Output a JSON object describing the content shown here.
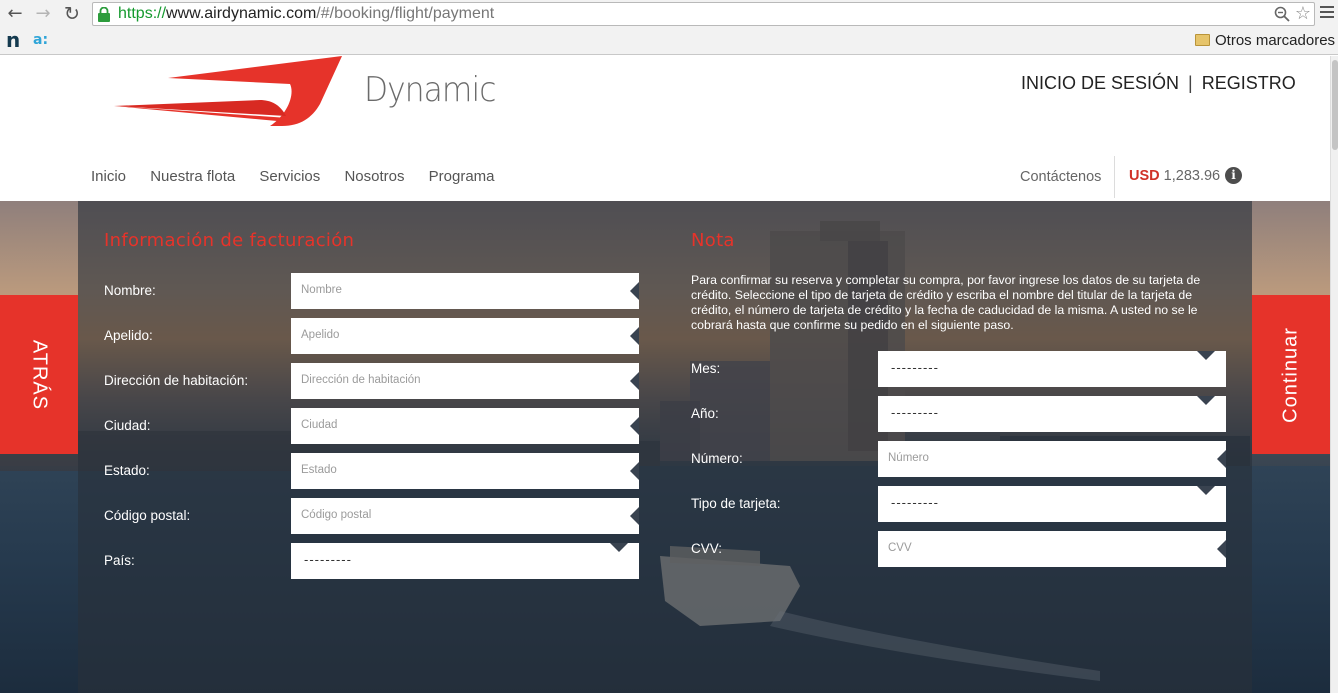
{
  "browser": {
    "url_scheme": "https://",
    "url_host": "www.airdynamic.com",
    "url_path": "/#/booking/flight/payment",
    "bookmark_n": "n",
    "bookmark_a": "a:",
    "other_bookmarks": "Otros marcadores"
  },
  "header": {
    "brand": "Dynamic",
    "login": "INICIO DE SESIÓN",
    "separator": "|",
    "register": "REGISTRO",
    "brand_color": "#e6332a"
  },
  "nav": {
    "items": [
      "Inicio",
      "Nuestra flota",
      "Servicios",
      "Nosotros",
      "Programa"
    ],
    "contact": "Contáctenos",
    "currency": "USD",
    "amount": "1,283.96",
    "info": "i"
  },
  "side": {
    "back": "ATRÁS",
    "continue": "Continuar"
  },
  "billing": {
    "title": "Información de facturación",
    "fields": [
      {
        "label": "Nombre:",
        "placeholder": "Nombre",
        "type": "input"
      },
      {
        "label": "Apelido:",
        "placeholder": "Apelido",
        "type": "input"
      },
      {
        "label": "Dirección de habitación:",
        "placeholder": "Dirección de habitación",
        "type": "input"
      },
      {
        "label": "Ciudad:",
        "placeholder": "Ciudad",
        "type": "input"
      },
      {
        "label": "Estado:",
        "placeholder": "Estado",
        "type": "input"
      },
      {
        "label": "Código postal:",
        "placeholder": "Código postal",
        "type": "input"
      },
      {
        "label": "País:",
        "value": "---------",
        "type": "select"
      }
    ]
  },
  "note": {
    "title": "Nota",
    "text": "Para confirmar su reserva y completar su compra, por favor ingrese los datos de su tarjeta de crédito. Seleccione el tipo de tarjeta de crédito y escriba el nombre del titular de la tarjeta de crédito, el número de tarjeta de crédito y la fecha de caducidad de la misma. A usted no se le cobrará hasta que confirme su pedido en el siguiente paso.",
    "fields": [
      {
        "label": "Mes:",
        "value": "---------",
        "type": "select"
      },
      {
        "label": "Año:",
        "value": "---------",
        "type": "select"
      },
      {
        "label": "Número:",
        "placeholder": "Número",
        "type": "input"
      },
      {
        "label": "Tipo de tarjeta:",
        "value": "---------",
        "type": "select"
      },
      {
        "label": "CVV:",
        "placeholder": "CVV",
        "type": "input"
      }
    ]
  }
}
